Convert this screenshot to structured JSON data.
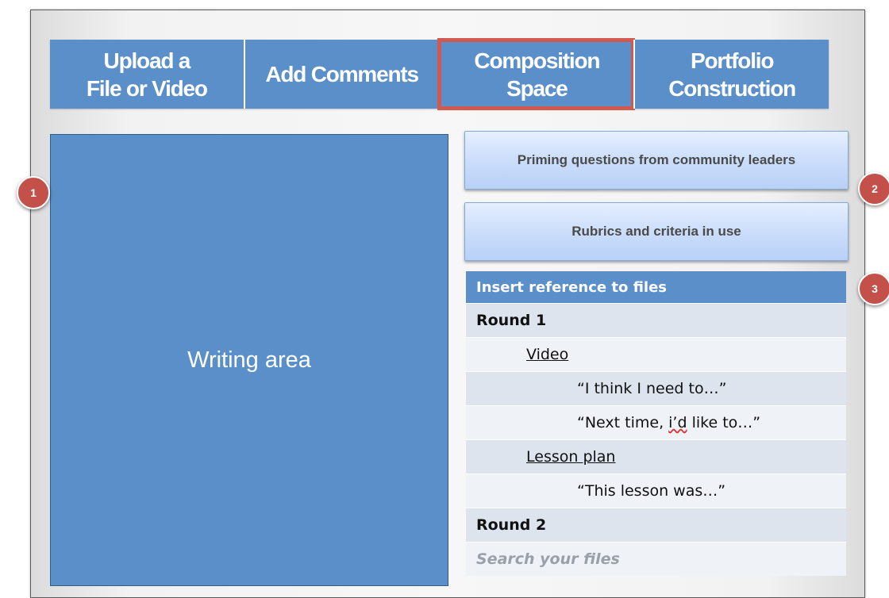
{
  "tabs": [
    {
      "label": "Upload a\nFile or Video",
      "active": false
    },
    {
      "label": "Add  Comments",
      "active": false
    },
    {
      "label": "Composition\nSpace",
      "active": true
    },
    {
      "label": "Portfolio\nConstruction",
      "active": false
    }
  ],
  "writing_area": {
    "label": "Writing area"
  },
  "buttons": {
    "priming": "Priming questions from community leaders",
    "rubrics": "Rubrics and criteria in use"
  },
  "references": {
    "header": "Insert reference to files",
    "round1": "Round 1",
    "video": "Video",
    "quote1": "“I think I need to…”",
    "quote2_prefix": "“Next time, ",
    "quote2_misspelled": "i’d",
    "quote2_suffix": " like to…”",
    "lesson_plan": "Lesson plan",
    "quote3": "“This lesson was…”",
    "round2": "Round 2",
    "search_placeholder": "Search your files"
  },
  "markers": {
    "m1": "1",
    "m2": "2",
    "m3": "3"
  },
  "colors": {
    "accent_blue": "#5b8fc9",
    "active_outline": "#d1594f",
    "marker_red": "#c4504a"
  }
}
